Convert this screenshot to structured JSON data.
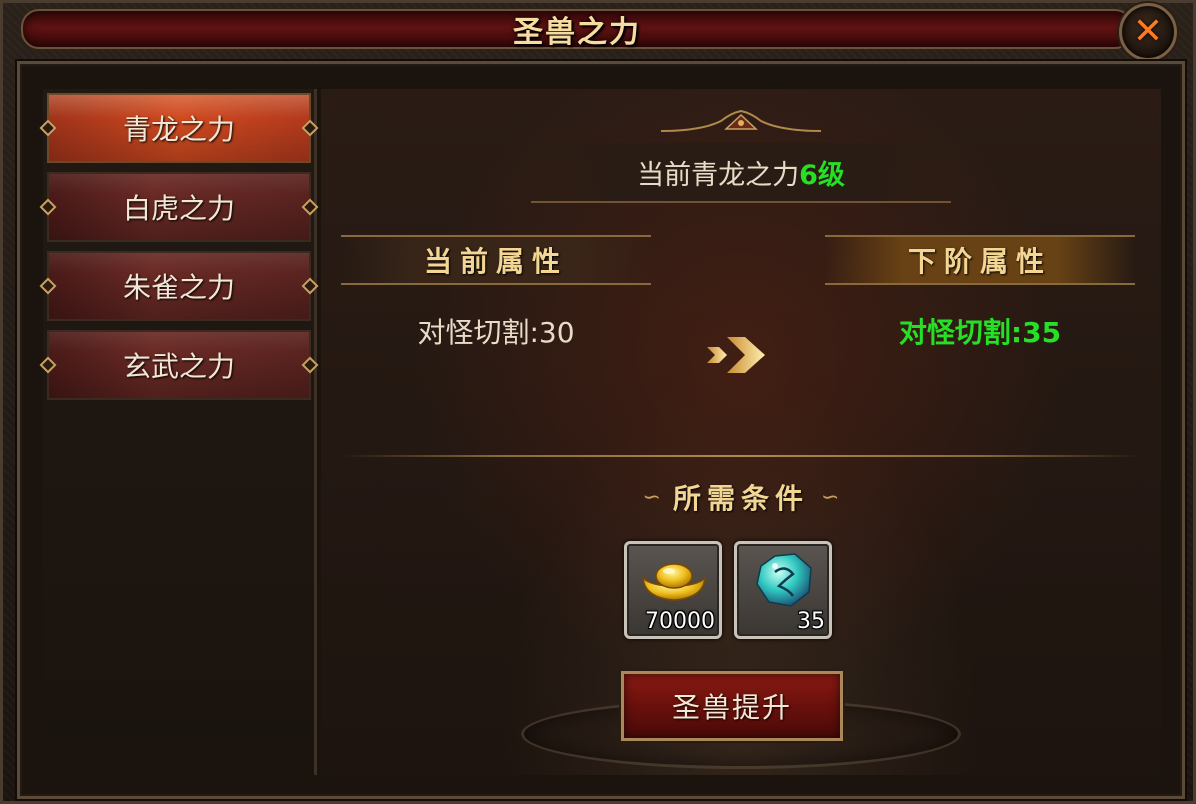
{
  "window": {
    "title": "圣兽之力",
    "close_symbol": "✕"
  },
  "tabs": [
    {
      "label": "青龙之力",
      "active": true
    },
    {
      "label": "白虎之力",
      "active": false
    },
    {
      "label": "朱雀之力",
      "active": false
    },
    {
      "label": "玄武之力",
      "active": false
    }
  ],
  "level": {
    "prefix": "当前青龙之力",
    "value": "6级"
  },
  "attributes": {
    "current_header": "当前属性",
    "next_header": "下阶属性",
    "current_value": "对怪切割:30",
    "next_value": "对怪切割:35"
  },
  "requirements": {
    "title": "所需条件",
    "items": [
      {
        "icon": "gold-ingot-icon",
        "count": "70000"
      },
      {
        "icon": "jade-stone-icon",
        "count": "35"
      }
    ]
  },
  "upgrade_button": {
    "label": "圣兽提升"
  },
  "colors": {
    "accent_gold": "#f4d694",
    "value_green": "#25e025",
    "close_orange": "#ff7a1e",
    "tab_active": "#d04a20"
  }
}
